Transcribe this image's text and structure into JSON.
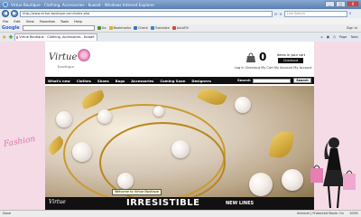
{
  "window": {
    "title": "Virtue Boutique - Clothing, Accessories - Kuwait - Windows Internet Explorer",
    "controls": [
      "_",
      "□",
      "X"
    ]
  },
  "address_bar": {
    "url": "http://www.virtue-boutique.com/index.php",
    "search_placeholder": "Live Search"
  },
  "menu": [
    "File",
    "Edit",
    "View",
    "Favorites",
    "Tools",
    "Help"
  ],
  "google_toolbar": {
    "logo": "Google",
    "items": [
      "Go",
      "Bookmarks",
      "Check",
      "Translate",
      "AutoFill"
    ],
    "signin": "Sign In"
  },
  "tabs": {
    "active_tab": "Virtue Boutique - Clothing, Accessories - Kuwait",
    "commands": [
      "Page",
      "Tools"
    ]
  },
  "site": {
    "logo": "Virtue",
    "logo_sub": "boutique",
    "cart": {
      "count": "0",
      "items_label": "Items in your cart",
      "checkout": "Checkout",
      "links": "Log In  Checkout  My Cart  My Account  My Account"
    },
    "nav": [
      "What's new",
      "Clothes",
      "Shoes",
      "Bags",
      "Accessories",
      "Coming Soon",
      "Designers"
    ],
    "search_label": "Search",
    "search_button": "Search",
    "hero_tooltip": "Welcome to Virtue Boutique",
    "banner": {
      "brand": "Virtue",
      "headline": "IRRESISTIBLE",
      "tagline": "NEW LINES"
    },
    "side_script": "Fashion"
  },
  "status": {
    "left": "Done",
    "zone": "Internet | Protected Mode: On",
    "zoom": "100%"
  }
}
